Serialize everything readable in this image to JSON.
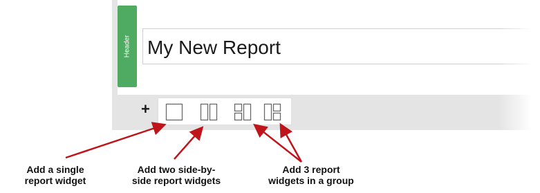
{
  "header_section": {
    "tab_label": "Header",
    "report_title": "My New Report"
  },
  "toolbar": {
    "add_symbol": "+",
    "buttons": [
      {
        "name": "single-widget-layout",
        "icon": "single-box-icon"
      },
      {
        "name": "two-side-by-side-layout",
        "icon": "two-columns-icon"
      },
      {
        "name": "three-group-layout-a",
        "icon": "three-group-icon-a"
      },
      {
        "name": "three-group-layout-b",
        "icon": "three-group-icon-b"
      }
    ]
  },
  "annotations": {
    "single": [
      "Add a single",
      "report widget"
    ],
    "two": [
      "Add two side-by-",
      "side report widgets"
    ],
    "three": [
      "Add 3 report",
      "widgets in a group"
    ]
  },
  "colors": {
    "header_tab": "#4fab62",
    "arrow": "#c0141b",
    "icon_stroke": "#6a6a6a"
  }
}
